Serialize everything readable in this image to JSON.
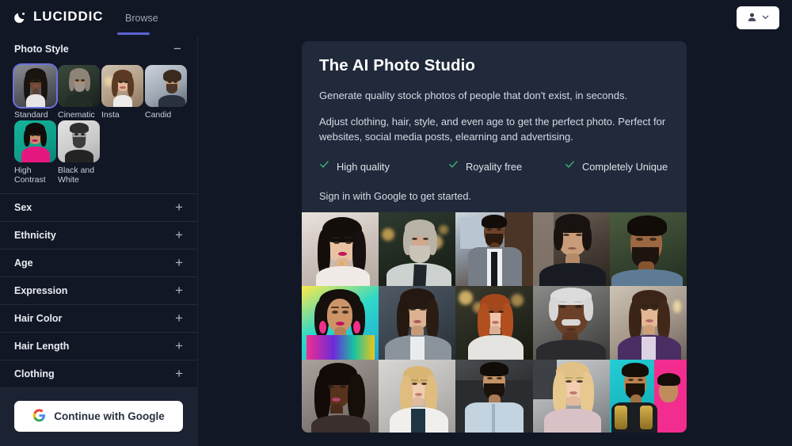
{
  "brand": {
    "name": "LUCIDDIC",
    "icon": "moon-icon"
  },
  "nav": {
    "items": [
      {
        "label": "Browse",
        "active": true
      }
    ]
  },
  "account": {
    "icon": "person-icon",
    "chevron": "chevron-down-icon"
  },
  "sidebar": {
    "photo_style": {
      "title": "Photo Style",
      "toggle_sign": "−",
      "options": [
        {
          "label": "Standard",
          "selected": true
        },
        {
          "label": "Cinematic",
          "selected": false
        },
        {
          "label": "Insta",
          "selected": false
        },
        {
          "label": "Candid",
          "selected": false
        },
        {
          "label": "High Contrast",
          "selected": false
        },
        {
          "label": "Black and White",
          "selected": false
        }
      ]
    },
    "accordions": [
      {
        "label": "Sex",
        "sign": "+"
      },
      {
        "label": "Ethnicity",
        "sign": "+"
      },
      {
        "label": "Age",
        "sign": "+"
      },
      {
        "label": "Expression",
        "sign": "+"
      },
      {
        "label": "Hair Color",
        "sign": "+"
      },
      {
        "label": "Hair Length",
        "sign": "+"
      },
      {
        "label": "Clothing",
        "sign": "+"
      }
    ],
    "signin": {
      "button_label": "Continue with Google",
      "icon": "google-icon"
    }
  },
  "main": {
    "card": {
      "title": "The AI Photo Studio",
      "paragraph1": "Generate quality stock photos of people that don't exist, in seconds.",
      "paragraph2": "Adjust clothing, hair, style, and even age to get the perfect photo. Perfect for websites, social media posts, elearning and advertising.",
      "features": [
        {
          "label": "High quality",
          "icon": "check-icon"
        },
        {
          "label": "Royality free",
          "icon": "check-icon"
        },
        {
          "label": "Completely Unique",
          "icon": "check-icon"
        }
      ],
      "signin_note": "Sign in with Google to get started."
    },
    "gallery": {
      "rows": 3,
      "cols": 5,
      "photos": [
        "asian-woman-bridal-portrait",
        "older-white-man-grey-beard-outdoors",
        "black-man-grey-suit-black-tie",
        "older-asian-man-dark-shirt",
        "indian-man-beard-blue-shirt",
        "latina-woman-colorful-makeup-earrings",
        "asian-woman-grey-blazer",
        "red-haired-woman-white-jacket",
        "older-black-man-white-hair-moustache",
        "brunette-woman-purple-blazer",
        "black-woman-curly-hair-studio",
        "blonde-woman-white-cardigan",
        "middle-eastern-man-light-blue-shirt",
        "blonde-woman-pink-scarf",
        "matador-costume-men-teal-background"
      ]
    }
  },
  "colors": {
    "page_bg": "#121726",
    "card_bg": "#212a3a",
    "accent": "#5b63d3",
    "check_green": "#3eb87a",
    "panel_border": "#242b3b",
    "button_white": "#ffffff"
  }
}
